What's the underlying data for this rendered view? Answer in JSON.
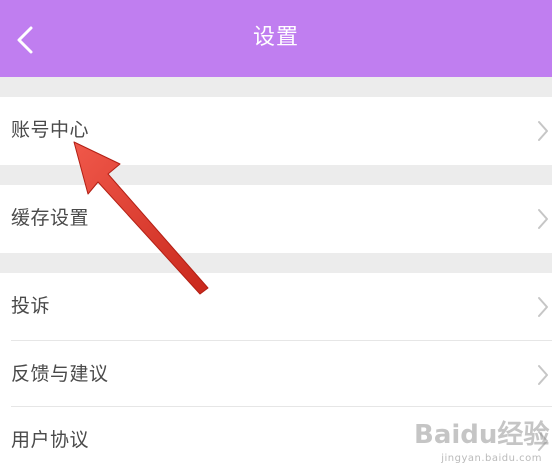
{
  "header": {
    "title": "设置",
    "back_icon": "chevron-left-icon",
    "bg_color": "#c07ef0"
  },
  "settings": {
    "account_center": "账号中心",
    "cache_settings": "缓存设置",
    "complaint": "投诉",
    "feedback": "反馈与建议",
    "user_agreement": "用户协议"
  },
  "icons": {
    "row_chevron": "chevron-right-icon"
  },
  "annotation": {
    "arrow_color": "#e23b2b"
  },
  "watermark": {
    "brand": "Baidu经验",
    "url": "jingyan.baidu.com"
  }
}
